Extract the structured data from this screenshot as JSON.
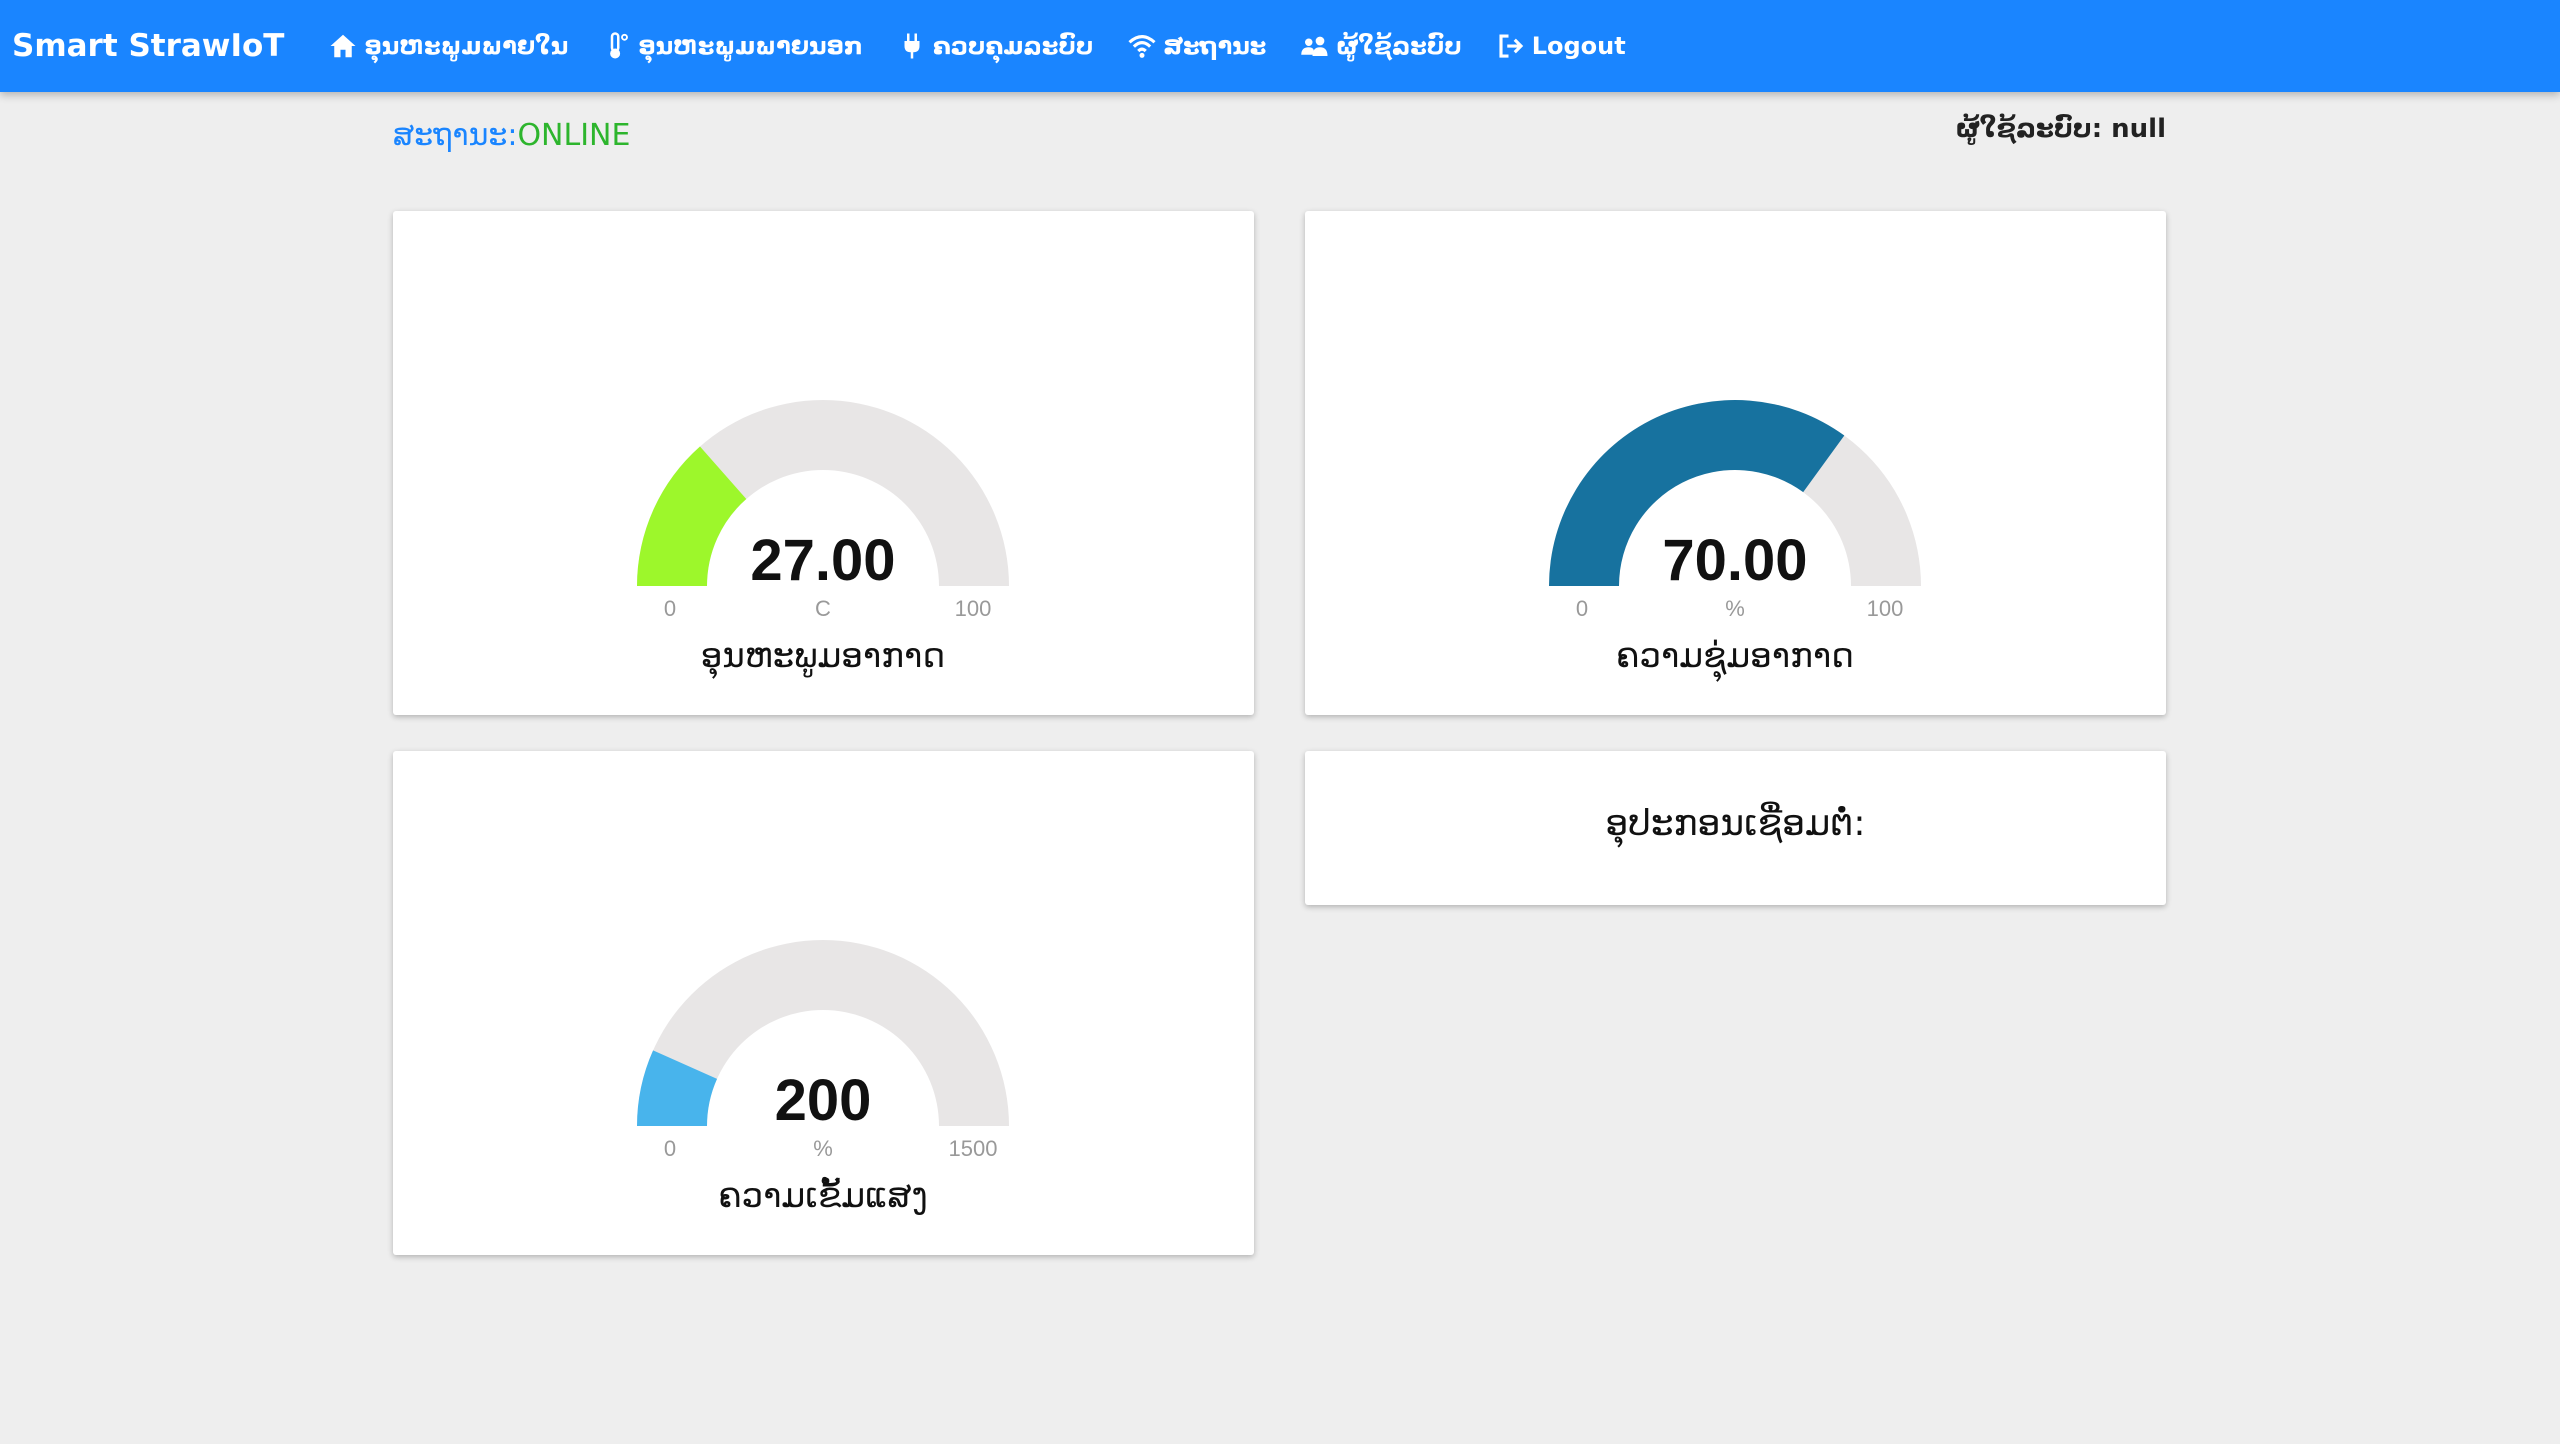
{
  "brand": "Smart StrawIoT",
  "nav": [
    {
      "label": "ອຸນຫະພູມພາຍໃນ",
      "icon": "home-icon"
    },
    {
      "label": "ອຸນຫະພູມພາຍນອກ",
      "icon": "thermometer-icon"
    },
    {
      "label": "ຄວບຄຸມລະບົບ",
      "icon": "plug-icon"
    },
    {
      "label": "ສະຖານະ",
      "icon": "wifi-icon"
    },
    {
      "label": "ຜູ້ໃຊ້ລະບົບ",
      "icon": "users-icon"
    },
    {
      "label": "Logout",
      "icon": "logout-icon"
    }
  ],
  "status": {
    "label": "ສະຖານະ:",
    "value": "ONLINE"
  },
  "user": {
    "label": "ຜູ້ໃຊ້ລະບົບ:",
    "value": "null"
  },
  "gauges": [
    {
      "id": "temp",
      "value": 27,
      "display": "27.00",
      "min": 0,
      "max": 100,
      "min_label": "0",
      "max_label": "100",
      "unit": "C",
      "label": "ອຸນຫະພູມອາກາດ",
      "color": "#9df72b"
    },
    {
      "id": "hum",
      "value": 70,
      "display": "70.00",
      "min": 0,
      "max": 100,
      "min_label": "0",
      "max_label": "100",
      "unit": "%",
      "label": "ຄວາມຊຸ່ມອາກາດ",
      "color": "#17729f"
    },
    {
      "id": "light",
      "value": 200,
      "display": "200",
      "min": 0,
      "max": 1500,
      "min_label": "0",
      "max_label": "1500",
      "unit": "%",
      "label": "ຄວາມເຂັ້ມແສງ",
      "color": "#48b4ec"
    }
  ],
  "gauge_track_color": "#e8e6e6",
  "devices": {
    "title": "ອຸປະກອນເຊື່ອມຕໍ່:"
  }
}
